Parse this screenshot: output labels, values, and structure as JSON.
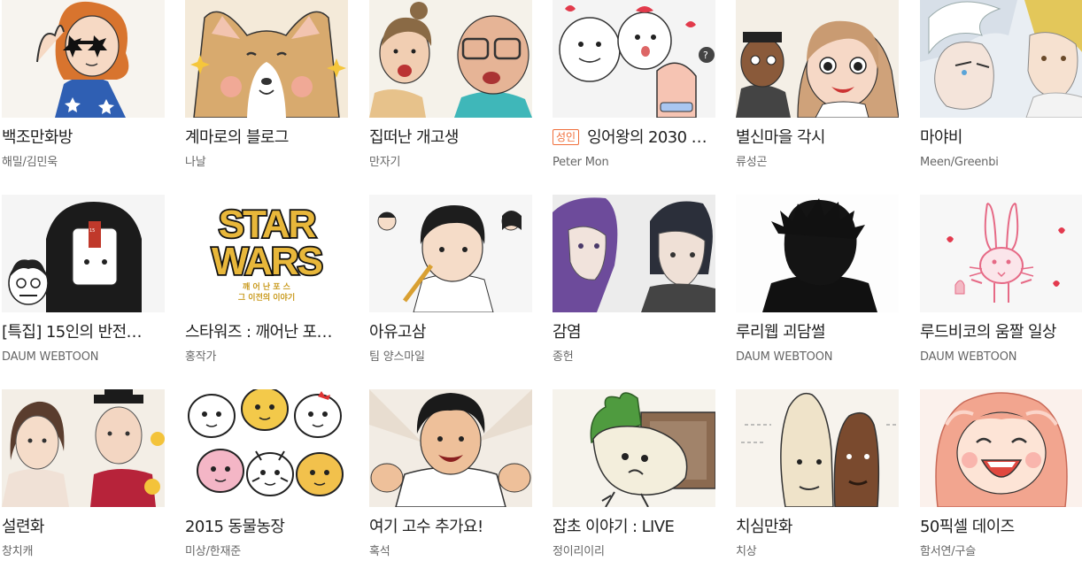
{
  "webtoons": [
    {
      "title": "백조만화방",
      "author": "해밀/김민욱",
      "art": "star-glasses-girl"
    },
    {
      "title": "계마로의 블로그",
      "author": "나날",
      "art": "corgi"
    },
    {
      "title": "집떠난 개고생",
      "author": "만자기",
      "art": "elderly-couple"
    },
    {
      "title": "잉어왕의 2030 …",
      "author": "Peter Mon",
      "badge": "성인",
      "art": "doodle-blobs"
    },
    {
      "title": "별신마을 각시",
      "author": "류성곤",
      "art": "village-bride"
    },
    {
      "title": "마야비",
      "author": "Meen/Greenbi",
      "art": "white-hair-boys"
    },
    {
      "title": "[특집] 15인의 반전…",
      "author": "DAUM WEBTOON",
      "art": "hooded-figure"
    },
    {
      "title": "스타워즈 : 깨어난 포…",
      "author": "홍작가",
      "art": "star-wars-logo",
      "logo": {
        "line1": "STAR",
        "line2": "WARS",
        "sub1": "깨 어 난  포 스",
        "sub2": "그  이전의  이야기"
      }
    },
    {
      "title": "아유고삼",
      "author": "팀 양스마일",
      "art": "student-pencil"
    },
    {
      "title": "감염",
      "author": "종헌",
      "art": "purple-hair-duo"
    },
    {
      "title": "루리웹 괴담썰",
      "author": "DAUM WEBTOON",
      "art": "shadow-silhouette"
    },
    {
      "title": "루드비코의 움짤 일상",
      "author": "DAUM WEBTOON",
      "art": "pink-rabbit"
    },
    {
      "title": "설련화",
      "author": "창치캐",
      "art": "hanbok-couple"
    },
    {
      "title": "2015 동물농장",
      "author": "미상/한재준",
      "art": "animal-crowd"
    },
    {
      "title": "여기 고수 추가요!",
      "author": "혹석",
      "art": "shouting-boy"
    },
    {
      "title": "잡초 이야기 : LIVE",
      "author": "정이리이리",
      "art": "radish-creature"
    },
    {
      "title": "치심만화",
      "author": "치상",
      "art": "tall-heads"
    },
    {
      "title": "50픽셀 데이즈",
      "author": "함서연/구슬",
      "art": "laughing-girl"
    }
  ],
  "colors": {
    "title": "#222222",
    "author": "#666666",
    "badge": "#f06e3a"
  }
}
